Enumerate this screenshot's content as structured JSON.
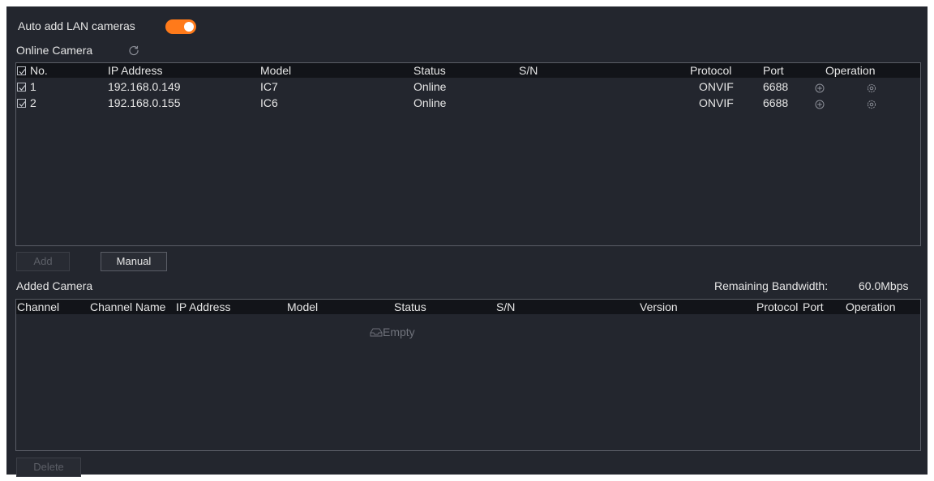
{
  "auto_add": {
    "label": "Auto add LAN cameras",
    "enabled": true,
    "accent": "#ff7a1a"
  },
  "online": {
    "title": "Online Camera",
    "refresh_icon": "refresh-icon",
    "headers": {
      "no": "No.",
      "ip": "IP Address",
      "model": "Model",
      "status": "Status",
      "sn": "S/N",
      "protocol": "Protocol",
      "port": "Port",
      "operation": "Operation"
    },
    "rows": [
      {
        "no": "1",
        "ip": "192.168.0.149",
        "model": "IC7",
        "status": "Online",
        "sn": "",
        "protocol": "ONVIF",
        "port": "6688",
        "checked": true
      },
      {
        "no": "2",
        "ip": "192.168.0.155",
        "model": "IC6",
        "status": "Online",
        "sn": "",
        "protocol": "ONVIF",
        "port": "6688",
        "checked": true
      }
    ],
    "add_label": "Add",
    "manual_label": "Manual"
  },
  "added": {
    "title": "Added Camera",
    "bandwidth_label": "Remaining Bandwidth:",
    "bandwidth_value": "60.0Mbps",
    "headers": {
      "channel": "Channel",
      "channel_name": "Channel Name",
      "ip": "IP Address",
      "model": "Model",
      "status": "Status",
      "sn": "S/N",
      "version": "Version",
      "protocol": "Protocol",
      "port": "Port",
      "operation": "Operation"
    },
    "empty_text": "Empty",
    "delete_label": "Delete"
  }
}
